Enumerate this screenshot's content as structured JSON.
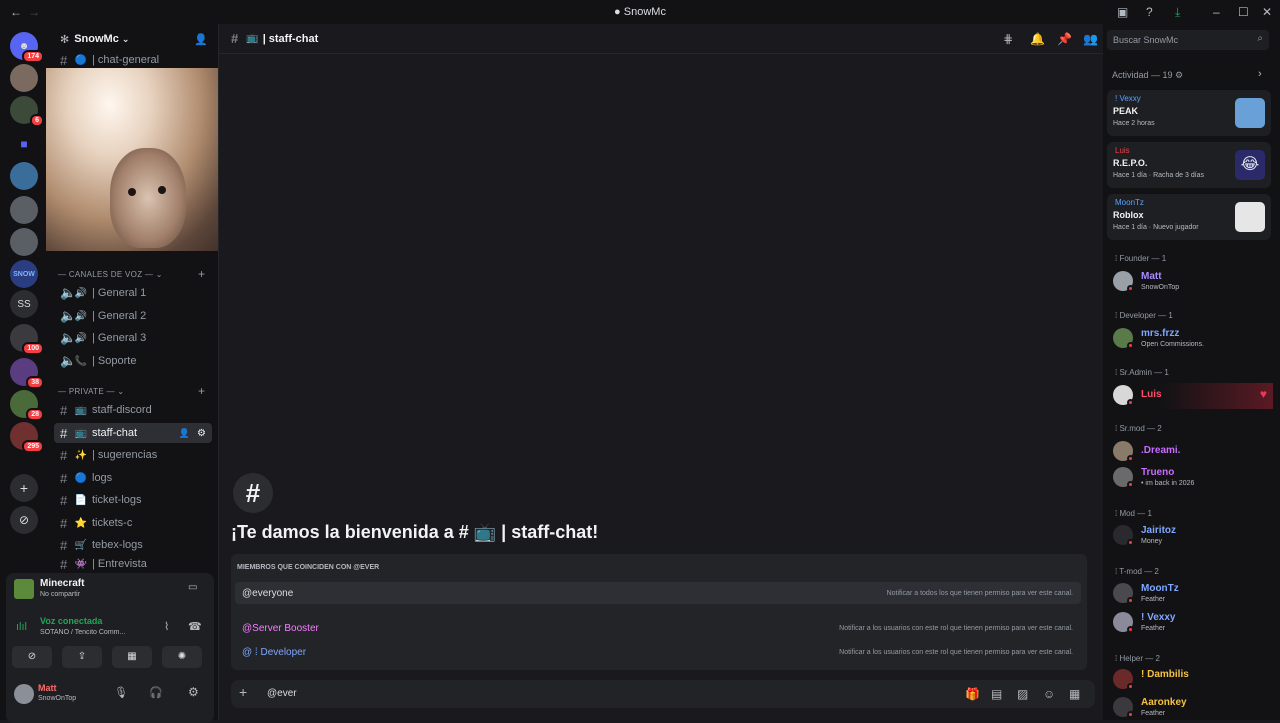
{
  "window": {
    "title": "SnowMc"
  },
  "rail": {
    "badges": [
      "174",
      "6",
      "100",
      "38",
      "28",
      "295"
    ],
    "text_server": "SS"
  },
  "sidebar": {
    "server_name": "SnowMc",
    "chat_general": "| chat-general",
    "voice_category": "CANALES DE VOZ",
    "voice_channels": [
      "| General 1",
      "| General 2",
      "| General 3",
      "| Soporte"
    ],
    "private_category": "PRIVATE",
    "text_channels": [
      "staff-discord",
      "staff-chat",
      "| sugerencias",
      "logs",
      "ticket-logs",
      "tickets-c",
      "tebex-logs",
      "| Entrevista"
    ]
  },
  "activity_panel": {
    "game": "Minecraft",
    "status": "No compartir"
  },
  "voice_panel": {
    "status": "Voz conectada",
    "channel": "SOTANO / Tencito Comm..."
  },
  "user_panel": {
    "name": "Matt",
    "status": "SnowOnTop"
  },
  "header": {
    "channel": "staff-chat"
  },
  "welcome": {
    "text": "¡Te damos la bienvenida a # 📺 | staff-chat!"
  },
  "mention_popup": {
    "title": "MIEMBROS QUE COINCIDEN CON @EVER",
    "options": [
      {
        "label": "@everyone",
        "desc": "Notificar a todos los que tienen permiso para ver este canal.",
        "color": "#dbdee1"
      },
      {
        "label": "@Server Booster",
        "desc": "Notificar a los usuarios con este rol que tienen permiso para ver este canal.",
        "color": "#f47fff"
      },
      {
        "label": "@ ⁞ Developer",
        "desc": "Notificar a los usuarios con este rol que tienen permiso para ver este canal.",
        "color": "#7fa7ff"
      }
    ]
  },
  "composer": {
    "value": "@ever"
  },
  "members": {
    "search_placeholder": "Buscar SnowMc",
    "activity_title": "Actividad — 19",
    "activity": [
      {
        "user": "! Vexxy",
        "game": "PEAK",
        "meta": "Hace 2 horas",
        "color": "#5aa2ff"
      },
      {
        "user": "Luis",
        "game": "R.E.P.O.",
        "meta": "Hace 1 día · Racha de 3 días",
        "color": "#f23f43"
      },
      {
        "user": "MoonTz",
        "game": "Roblox",
        "meta": "Hace 1 día · Nuevo jugador",
        "color": "#5aa2ff"
      }
    ],
    "roles": [
      {
        "title": "⁞ Founder — 1",
        "members": [
          {
            "name": "Matt",
            "status": "SnowOnTop",
            "color": "#a78bff"
          }
        ]
      },
      {
        "title": "⁞ Developer — 1",
        "members": [
          {
            "name": "mrs.frzz",
            "status": "Open Commissions.",
            "color": "#7fa7ff"
          }
        ]
      },
      {
        "title": "⁞ Sr.Admin — 1",
        "members": [
          {
            "name": "Luis",
            "status": "",
            "color": "#ff4d6d"
          }
        ]
      },
      {
        "title": "⁞ Sr.mod — 2",
        "members": [
          {
            "name": ".Dreami.",
            "status": "",
            "color": "#c76cff"
          },
          {
            "name": "Trueno",
            "status": "• im back in 2026",
            "color": "#c76cff"
          }
        ]
      },
      {
        "title": "⁞ Mod — 1",
        "members": [
          {
            "name": "Jairitoz",
            "status": "Money",
            "color": "#7fa7ff"
          }
        ]
      },
      {
        "title": "⁞ T-mod — 2",
        "members": [
          {
            "name": "MoonTz",
            "status": "Feather",
            "color": "#7fa7ff"
          },
          {
            "name": "! Vexxy",
            "status": "Feather",
            "color": "#7fa7ff"
          }
        ]
      },
      {
        "title": "⁞ Helper — 2",
        "members": [
          {
            "name": "! Dambilis",
            "status": "",
            "color": "#f5c242"
          },
          {
            "name": "Aaronkey",
            "status": "Feather",
            "color": "#f5c242"
          }
        ]
      }
    ]
  },
  "colors": {
    "accent": "#5865f2",
    "danger": "#f23f43",
    "online": "#23a55a",
    "bg": "#1a1a1e"
  }
}
